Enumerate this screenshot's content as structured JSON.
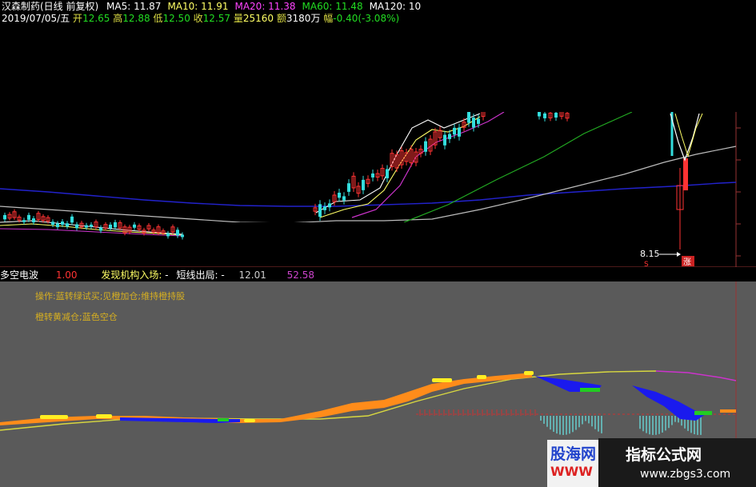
{
  "header": {
    "stock": "汉森制药(日线 前复权)",
    "ma_items": [
      {
        "label": "MA5:",
        "value": "11.87",
        "color": "#ffffff"
      },
      {
        "label": "MA10:",
        "value": "11.91",
        "color": "#ffff66"
      },
      {
        "label": "MA20:",
        "value": "11.38",
        "color": "#ff44ff"
      },
      {
        "label": "MA60:",
        "value": "11.48",
        "color": "#22dd22"
      },
      {
        "label": "MA120:",
        "value": "10",
        "color": "#ffffff"
      }
    ],
    "quote": {
      "date": "2019/07/05/五",
      "open_label": "开",
      "open": "12.65",
      "high_label": "高",
      "high": "12.88",
      "low_label": "低",
      "low": "12.50",
      "close_label": "收",
      "close": "12.57",
      "volume_label": "量",
      "volume": "25160",
      "amount_label": "额",
      "amount": "3180万",
      "change_label": "幅",
      "change": "-0.40(-3.08%)"
    }
  },
  "price_panel": {
    "low_marker": "8.15",
    "badge": "涨",
    "badge_small": "S"
  },
  "indicator": {
    "name": "多空电波",
    "value1": "1.00",
    "enter_label": "发现机构入场:",
    "enter_value": "-",
    "exit_label": "短线出局:",
    "exit_value": "-",
    "value2": "12.01",
    "value3": "52.58",
    "note1": "操作:蓝转绿试买;见橙加仓;维持橙持股",
    "note2": "橙转黄减仓;蓝色空仓"
  },
  "watermarks": {
    "left": "股海网",
    "left_sub": "WWW",
    "right_title": "指标公式网",
    "right_url": "www.zbgs3.com"
  },
  "colors": {
    "background_top": "#000000",
    "background_bottom": "#5a5a5a",
    "up": "#ff3333",
    "down": "#33dddd",
    "ma5": "#ffffff",
    "ma10": "#ffff66",
    "ma20": "#cc33cc",
    "ma60": "#22aa22",
    "ma120": "#bbbbbb",
    "long_ma": "#2222cc",
    "wave_orange": "#ff8c1a",
    "wave_yellow": "#ffee22",
    "wave_blue": "#1a1aee",
    "wave_green": "#22cc22",
    "signal_line": "#d8d840",
    "top_line": "#cc33cc",
    "hist_cyan": "#66cccc",
    "hist_red": "#cc3333"
  },
  "chart_data": [
    {
      "type": "candlestick",
      "title": "汉森制药(日线 前复权)",
      "y_unit": "price",
      "annotations": [
        {
          "text": "8.15",
          "meaning": "period low"
        }
      ],
      "series": [
        {
          "name": "MA5",
          "last": 11.87
        },
        {
          "name": "MA10",
          "last": 11.91
        },
        {
          "name": "MA20",
          "last": 11.38
        },
        {
          "name": "MA60",
          "last": 11.48
        },
        {
          "name": "MA120",
          "last": 10
        }
      ],
      "last_bar": {
        "date": "2019/07/05",
        "open": 12.65,
        "high": 12.88,
        "low": 12.5,
        "close": 12.57,
        "volume": 25160,
        "amount": "3180万",
        "change": -0.4,
        "change_pct": -3.08
      }
    },
    {
      "type": "area",
      "title": "多空电波",
      "legend_values": [
        1.0,
        12.01,
        52.58
      ],
      "notes": [
        "操作:蓝转绿试买;见橙加仓;维持橙持股",
        "橙转黄减仓;蓝色空仓"
      ]
    }
  ]
}
